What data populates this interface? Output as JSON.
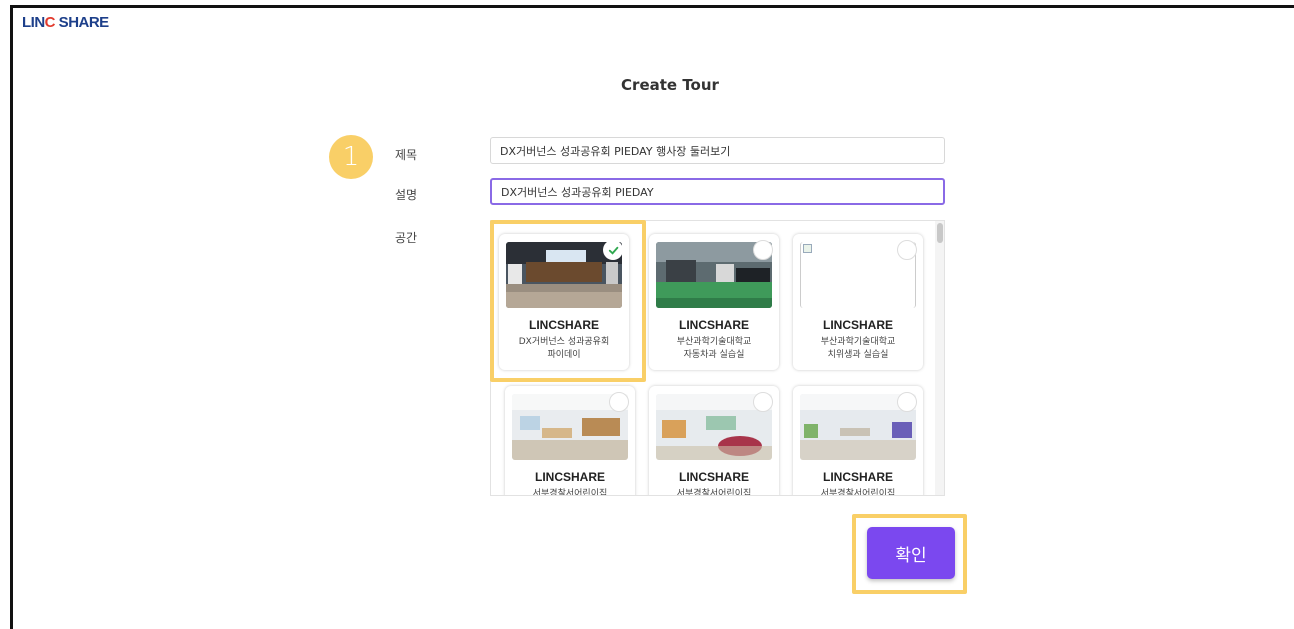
{
  "app": {
    "logo_text_a": "LIN",
    "logo_text_b": "C",
    "logo_text_c": " SHARE"
  },
  "page": {
    "title": "Create Tour",
    "step_number": "1"
  },
  "form": {
    "title_label": "제목",
    "title_value": "DX거버넌스 성과공유회 PIEDAY 행사장 둘러보기",
    "desc_label": "설명",
    "desc_value": "DX거버넌스 성과공유회 PIEDAY",
    "space_label": "공간"
  },
  "spaces": [
    {
      "name": "LINCSHARE",
      "desc_line1": "DX거버넌스 성과공유회",
      "desc_line2": "파이데이",
      "selected": true,
      "thumb": "event-hall"
    },
    {
      "name": "LINCSHARE",
      "desc_line1": "부산과학기술대학교",
      "desc_line2": "자동차과 실습실",
      "selected": false,
      "thumb": "garage"
    },
    {
      "name": "LINCSHARE",
      "desc_line1": "부산과학기술대학교",
      "desc_line2": "치위생과 실습실",
      "selected": false,
      "thumb": "broken-image"
    },
    {
      "name": "LINCSHARE",
      "desc_line1": "서부경찰서어린이집",
      "desc_line2": "",
      "selected": false,
      "thumb": "classroom-1"
    },
    {
      "name": "LINCSHARE",
      "desc_line1": "서부경찰서어린이집",
      "desc_line2": "",
      "selected": false,
      "thumb": "classroom-2"
    },
    {
      "name": "LINCSHARE",
      "desc_line1": "서부경찰서어린이집",
      "desc_line2": "",
      "selected": false,
      "thumb": "classroom-3"
    }
  ],
  "actions": {
    "confirm_label": "확인"
  },
  "colors": {
    "accent": "#7b48ef",
    "highlight": "#f9cf67",
    "check_green": "#2fa84f"
  }
}
